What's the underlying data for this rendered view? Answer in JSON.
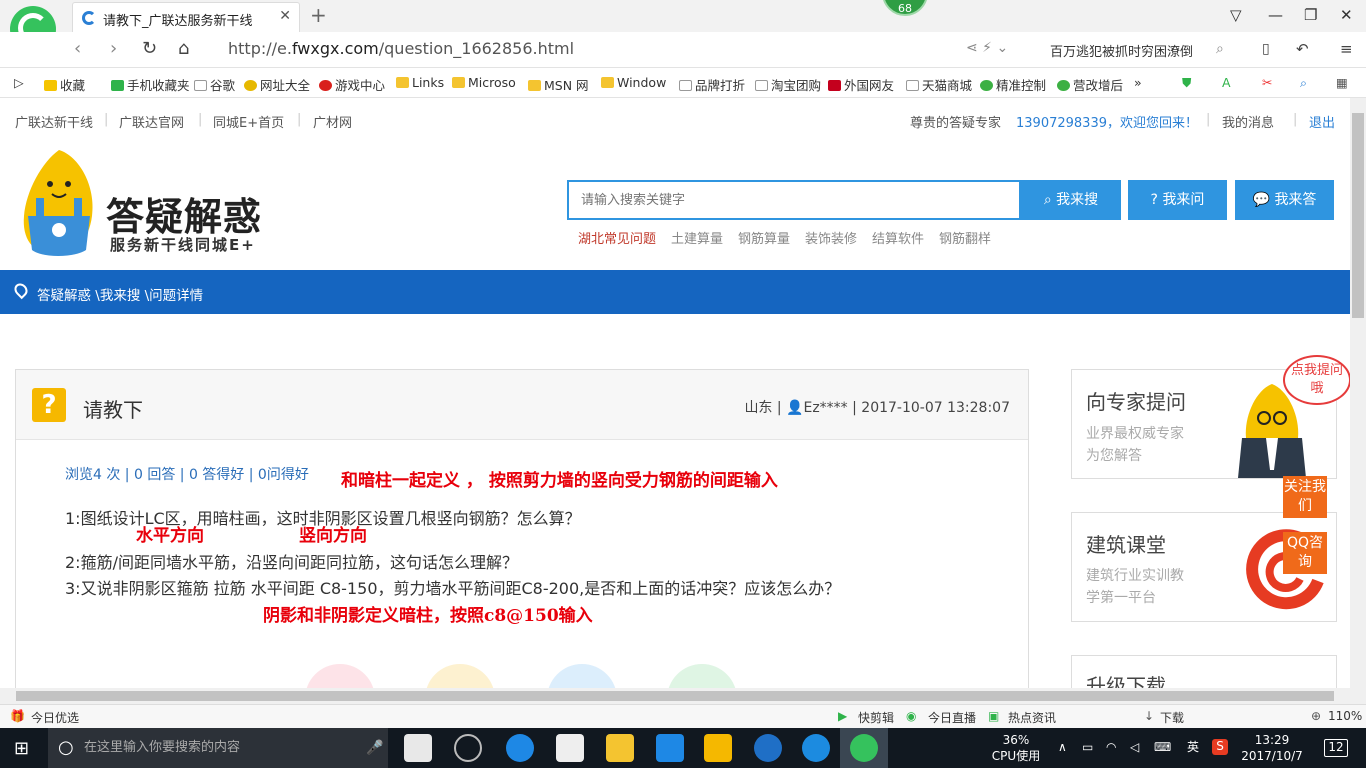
{
  "browser": {
    "tab_title": "请教下_广联达服务新干线",
    "badge_count": "68",
    "url_prefix": "http://e.",
    "url_domain": "fwxgx.com",
    "url_path": "/question_1662856.html",
    "hot_search": "百万逃犯被抓时穷困潦倒",
    "bookmarks": [
      "收藏",
      "手机收藏夹",
      "谷歌",
      "网址大全",
      "游戏中心",
      "Links",
      "Microso",
      "MSN 网",
      "Window",
      "品牌打折",
      "淘宝团购",
      "外国网友",
      "天猫商城",
      "精准控制",
      "营改增后"
    ]
  },
  "site": {
    "top_links": [
      "广联达新干线",
      "广联达官网",
      "同城E+首页",
      "广材网"
    ],
    "welcome_prefix": "尊贵的答疑专家",
    "welcome_user": "13907298339，欢迎您回来！",
    "my_messages": "我的消息",
    "logout": "退出",
    "brand": "答疑解惑",
    "brand_sub": "服务新干线同城E+",
    "search_placeholder": "请输入搜索关键字",
    "btn_search": "我来搜",
    "btn_ask": "我来问",
    "btn_answer": "我来答",
    "hot_words": [
      "湖北常见问题",
      "土建算量",
      "钢筋算量",
      "装饰装修",
      "结算软件",
      "钢筋翻样"
    ],
    "breadcrumb": "答疑解惑 \\我来搜 \\问题详情"
  },
  "question": {
    "title": "请教下",
    "meta": "山东 | 👤Ez**** | 2017-10-07 13:28:07",
    "stats": "浏览4 次 | 0 回答 | 0 答得好 | 0问得好",
    "lines": [
      "1:图纸设计LC区，用暗柱画，这时非阴影区设置几根竖向钢筋？怎么算？",
      "2:箍筋/间距同墙水平筋，沿竖向间距同拉筋，这句话怎么理解？",
      "3:又说非阴影区箍筋   拉筋  水平间距 C8-150，剪力墙水平筋间距C8-200,是否和上面的话冲突？应该怎么办？"
    ],
    "annotations": {
      "top": "和暗柱一起定义 ， 按照剪力墙的竖向受力钢筋的间距输入",
      "horizontal": "水平方向",
      "vertical": "竖向方向",
      "bottom": "阴影和非阴影定义暗柱，按照c8@150输入"
    }
  },
  "sidebar": {
    "expert_title": "向专家提问",
    "expert_sub1": "业界最权威专家",
    "expert_sub2": "为您解答",
    "bubble": "点我提问哦",
    "class_title": "建筑课堂",
    "class_sub1": "建筑行业实训教",
    "class_sub2": "学第一平台",
    "upgrade_title": "升级下载",
    "follow": "关注我们",
    "qq": "QQ咨询"
  },
  "statusbar": {
    "left": "今日优选",
    "items": [
      "快剪辑",
      "今日直播",
      "热点资讯",
      "下载"
    ],
    "zoom": "110%"
  },
  "taskbar": {
    "search_placeholder": "在这里输入你要搜索的内容",
    "cpu_percent": "36%",
    "cpu_label": "CPU使用",
    "ime": "英",
    "time": "13:29",
    "date": "2017/10/7",
    "notif_count": "12"
  },
  "colors": {
    "brand_blue": "#1565c0",
    "button_blue": "#2f95e0",
    "annotation_red": "#e8000b",
    "accent_orange": "#f06a1a"
  }
}
